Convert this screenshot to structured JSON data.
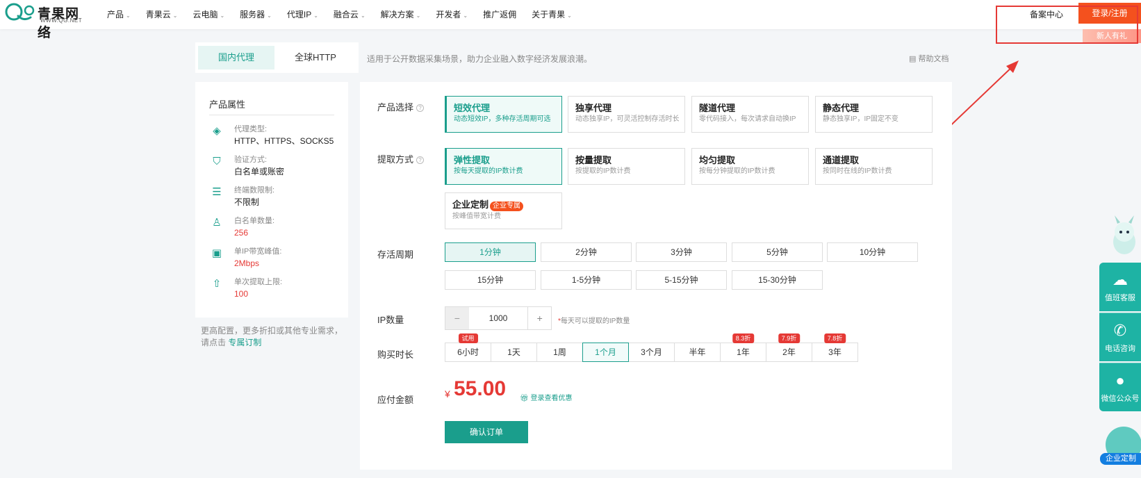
{
  "header": {
    "logo_text": "青果网络",
    "logo_url": "WWW.QG.NET",
    "nav": [
      "产品",
      "青果云",
      "云电脑",
      "服务器",
      "代理IP",
      "融合云",
      "解决方案",
      "开发者",
      "推广返佣",
      "关于青果"
    ],
    "nav_has_menu": [
      true,
      true,
      true,
      true,
      true,
      true,
      true,
      true,
      false,
      true
    ],
    "beian": "备案中心",
    "login": "登录/注册",
    "gift": "新人有礼"
  },
  "tabs": {
    "domestic": "国内代理",
    "global": "全球HTTP"
  },
  "subtitle": "适用于公开数据采集场景，助力企业融入数字经济发展浪潮。",
  "help": "帮助文档",
  "sidebar": {
    "title": "产品属性",
    "attrs": [
      {
        "icon": "layers-icon",
        "key": "代理类型:",
        "value": "HTTP、HTTPS、SOCKS5",
        "red": false
      },
      {
        "icon": "shield-check-icon",
        "key": "验证方式:",
        "value": "白名单或账密",
        "red": false
      },
      {
        "icon": "sliders-icon",
        "key": "终端数限制:",
        "value": "不限制",
        "red": false
      },
      {
        "icon": "user-list-icon",
        "key": "白名单数量:",
        "value": "256",
        "red": true
      },
      {
        "icon": "bandwidth-icon",
        "key": "单IP带宽峰值:",
        "value": "2Mbps",
        "red": true
      },
      {
        "icon": "upload-icon",
        "key": "单次提取上限:",
        "value": "100",
        "red": true
      }
    ],
    "note": "更高配置，更多折扣或其他专业需求，请点击",
    "note_link": "专属订制"
  },
  "product": {
    "label": "产品选择",
    "cards": [
      {
        "title": "短效代理",
        "desc": "动态短效IP，多种存活周期可选"
      },
      {
        "title": "独享代理",
        "desc": "动态独享IP，可灵活控制存活时长"
      },
      {
        "title": "隧道代理",
        "desc": "零代码接入，每次请求自动换IP"
      },
      {
        "title": "静态代理",
        "desc": "静态独享IP，IP固定不变"
      }
    ]
  },
  "extract": {
    "label": "提取方式",
    "cards": [
      {
        "title": "弹性提取",
        "desc": "按每天提取的IP数计费"
      },
      {
        "title": "按量提取",
        "desc": "按提取的IP数计费"
      },
      {
        "title": "均匀提取",
        "desc": "按每分钟提取的IP数计费"
      },
      {
        "title": "通道提取",
        "desc": "按同时在线的IP数计费"
      },
      {
        "title": "企业定制",
        "desc": "按峰值带宽计费",
        "badge": "企业专属"
      }
    ]
  },
  "period": {
    "label": "存活周期",
    "options": [
      "1分钟",
      "2分钟",
      "3分钟",
      "5分钟",
      "10分钟",
      "15分钟",
      "1-5分钟",
      "5-15分钟",
      "15-30分钟"
    ]
  },
  "ip_count": {
    "label": "IP数量",
    "minus": "−",
    "value": "1000",
    "plus": "+",
    "tip_star": "*",
    "tip": "每天可以提取的IP数量"
  },
  "duration": {
    "label": "购买时长",
    "options": [
      {
        "text": "6小时",
        "flag": "试用"
      },
      {
        "text": "1天",
        "flag": ""
      },
      {
        "text": "1周",
        "flag": ""
      },
      {
        "text": "1个月",
        "flag": ""
      },
      {
        "text": "3个月",
        "flag": ""
      },
      {
        "text": "半年",
        "flag": ""
      },
      {
        "text": "1年",
        "flag": "8.3折"
      },
      {
        "text": "2年",
        "flag": "7.9折"
      },
      {
        "text": "3年",
        "flag": "7.8折"
      }
    ]
  },
  "payment": {
    "label": "应付金额",
    "currency": "¥",
    "amount": "55.00",
    "coupon": "登录查看优惠"
  },
  "confirm": "确认订单",
  "float_bar": {
    "items": [
      "值班客服",
      "电话咨询",
      "微信公众号"
    ],
    "enterprise": "企业定制"
  },
  "colors": {
    "accent": "#1a9e8c",
    "red": "#e53935",
    "orange": "#f4511e",
    "float": "#1eb3a4"
  }
}
